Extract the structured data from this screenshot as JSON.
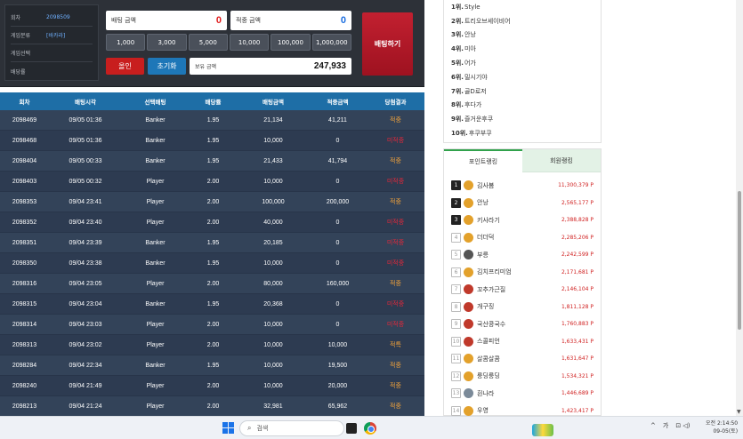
{
  "info": {
    "rows": [
      {
        "label": "회차",
        "value": "2098509"
      },
      {
        "label": "게임분류",
        "value": "[바카라]"
      },
      {
        "label": "게임선택",
        "value": ""
      },
      {
        "label": "배당률",
        "value": ""
      }
    ]
  },
  "bet": {
    "bet_amount_label": "배팅 금액",
    "bet_amount_value": "0",
    "win_amount_label": "적중 금액",
    "win_amount_value": "0",
    "chips": [
      "1,000",
      "3,000",
      "5,000",
      "10,000",
      "100,000",
      "1,000,000"
    ],
    "all_in_label": "올인",
    "reset_label": "초기화",
    "balance_label": "보유 금액",
    "balance_value": "247,933",
    "place_bet_label": "배팅하기"
  },
  "history": {
    "columns": [
      "회차",
      "배팅시각",
      "선택배팅",
      "배당률",
      "배팅금액",
      "적중금액",
      "당첨결과"
    ],
    "rows": [
      [
        "2098469",
        "09/05 01:36",
        "Banker",
        "1.95",
        "21,134",
        "41,211",
        "적중"
      ],
      [
        "2098468",
        "09/05 01:36",
        "Banker",
        "1.95",
        "10,000",
        "0",
        "미적중"
      ],
      [
        "2098404",
        "09/05 00:33",
        "Banker",
        "1.95",
        "21,433",
        "41,794",
        "적중"
      ],
      [
        "2098403",
        "09/05 00:32",
        "Player",
        "2.00",
        "10,000",
        "0",
        "미적중"
      ],
      [
        "2098353",
        "09/04 23:41",
        "Player",
        "2.00",
        "100,000",
        "200,000",
        "적중"
      ],
      [
        "2098352",
        "09/04 23:40",
        "Player",
        "2.00",
        "40,000",
        "0",
        "미적중"
      ],
      [
        "2098351",
        "09/04 23:39",
        "Banker",
        "1.95",
        "20,185",
        "0",
        "미적중"
      ],
      [
        "2098350",
        "09/04 23:38",
        "Banker",
        "1.95",
        "10,000",
        "0",
        "미적중"
      ],
      [
        "2098316",
        "09/04 23:05",
        "Player",
        "2.00",
        "80,000",
        "160,000",
        "적중"
      ],
      [
        "2098315",
        "09/04 23:04",
        "Banker",
        "1.95",
        "20,368",
        "0",
        "미적중"
      ],
      [
        "2098314",
        "09/04 23:03",
        "Player",
        "2.00",
        "10,000",
        "0",
        "미적중"
      ],
      [
        "2098313",
        "09/04 23:02",
        "Player",
        "2.00",
        "10,000",
        "10,000",
        "적특"
      ],
      [
        "2098284",
        "09/04 22:34",
        "Banker",
        "1.95",
        "10,000",
        "19,500",
        "적중"
      ],
      [
        "2098240",
        "09/04 21:49",
        "Player",
        "2.00",
        "10,000",
        "20,000",
        "적중"
      ],
      [
        "2098213",
        "09/04 21:24",
        "Player",
        "2.00",
        "32,981",
        "65,962",
        "적중"
      ]
    ],
    "result_colors": {
      "win": "#f3a33b",
      "lose": "#e0283a"
    }
  },
  "ranking_list": [
    {
      "rank": "1위.",
      "name": "Style"
    },
    {
      "rank": "2위.",
      "name": "트리오브세이비어"
    },
    {
      "rank": "3위.",
      "name": "안낭"
    },
    {
      "rank": "4위.",
      "name": "미아"
    },
    {
      "rank": "5위.",
      "name": "어가"
    },
    {
      "rank": "6위.",
      "name": "밀시기야"
    },
    {
      "rank": "7위.",
      "name": "골D로저"
    },
    {
      "rank": "8위.",
      "name": "후다가"
    },
    {
      "rank": "9위.",
      "name": "즐거운후쿠"
    },
    {
      "rank": "10위.",
      "name": "후쿠부쿠"
    }
  ],
  "rank_tabs": {
    "point": "포인트랭킹",
    "member": "회원랭킹"
  },
  "point_ranking": [
    {
      "n": "1",
      "name": "김사봄",
      "pts": "11,300,379 P",
      "avatar": "#e3a12b"
    },
    {
      "n": "2",
      "name": "안낭",
      "pts": "2,565,177 P",
      "avatar": "#e3a12b"
    },
    {
      "n": "3",
      "name": "키사라기",
      "pts": "2,388,828 P",
      "avatar": "#e3a12b"
    },
    {
      "n": "4",
      "name": "더더덕",
      "pts": "2,285,206 P",
      "avatar": "#e3a12b"
    },
    {
      "n": "5",
      "name": "부릉",
      "pts": "2,242,599 P",
      "avatar": "#555555"
    },
    {
      "n": "6",
      "name": "김치프리미엄",
      "pts": "2,171,681 P",
      "avatar": "#e3a12b"
    },
    {
      "n": "7",
      "name": "꼬추가근질",
      "pts": "2,146,104 P",
      "avatar": "#c0392b"
    },
    {
      "n": "8",
      "name": "개구징",
      "pts": "1,811,128 P",
      "avatar": "#c0392b"
    },
    {
      "n": "9",
      "name": "국산콩국수",
      "pts": "1,760,883 P",
      "avatar": "#c0392b"
    },
    {
      "n": "10",
      "name": "스콜피언",
      "pts": "1,633,431 P",
      "avatar": "#c0392b"
    },
    {
      "n": "11",
      "name": "살콤살콤",
      "pts": "1,631,647 P",
      "avatar": "#e3a12b"
    },
    {
      "n": "12",
      "name": "룽딩룽딩",
      "pts": "1,534,321 P",
      "avatar": "#e3a12b"
    },
    {
      "n": "13",
      "name": "흰나라",
      "pts": "1,446,689 P",
      "avatar": "#7b8a99"
    },
    {
      "n": "14",
      "name": "우영",
      "pts": "1,423,417 P",
      "avatar": "#e3a12b"
    }
  ],
  "taskbar": {
    "search_placeholder": "검색",
    "tray_chevron": "^",
    "tray_ime": "가",
    "tray_icons": "⊡ ◁)",
    "time": "오전 2:14:50",
    "date": "09-05(토)"
  }
}
